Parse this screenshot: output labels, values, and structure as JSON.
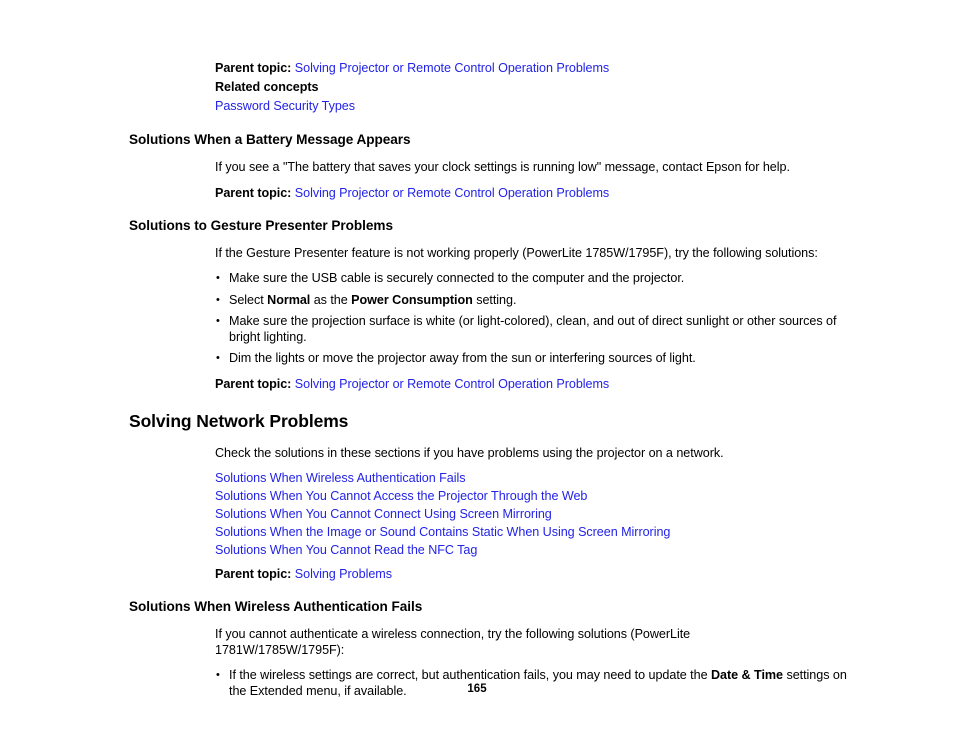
{
  "page": {
    "number": "165",
    "link_color": "#2323e8",
    "text_color": "#000000",
    "background_color": "#ffffff"
  },
  "blocks": {
    "top_parent_topic": {
      "label": "Parent topic:",
      "link": "Solving Projector or Remote Control Operation Problems"
    },
    "related_concepts": {
      "label": "Related concepts",
      "link": "Password Security Types"
    },
    "battery_section": {
      "heading": "Solutions When a Battery Message Appears",
      "paragraph": "If you see a \"The battery that saves your clock settings is running low\" message, contact Epson for help.",
      "parent_topic_label": "Parent topic:",
      "parent_topic_link": "Solving Projector or Remote Control Operation Problems"
    },
    "gesture_section": {
      "heading": "Solutions to Gesture Presenter Problems",
      "paragraph": "If the Gesture Presenter feature is not working properly (PowerLite 1785W/1795F), try the following solutions:",
      "bullets": [
        {
          "parts": [
            {
              "text": "Make sure the USB cable is securely connected to the computer and the projector.",
              "bold": false
            }
          ]
        },
        {
          "parts": [
            {
              "text": "Select ",
              "bold": false
            },
            {
              "text": "Normal",
              "bold": true
            },
            {
              "text": " as the ",
              "bold": false
            },
            {
              "text": "Power Consumption",
              "bold": true
            },
            {
              "text": " setting.",
              "bold": false
            }
          ]
        },
        {
          "parts": [
            {
              "text": "Make sure the projection surface is white (or light-colored), clean, and out of direct sunlight or other sources of bright lighting.",
              "bold": false
            }
          ]
        },
        {
          "parts": [
            {
              "text": "Dim the lights or move the projector away from the sun or interfering sources of light.",
              "bold": false
            }
          ]
        }
      ],
      "bullet_1_text": "Make sure the USB cable is securely connected to the computer and the projector.",
      "bullet_2_prefix": "Select ",
      "bullet_2_bold_a": "Normal",
      "bullet_2_middle": " as the ",
      "bullet_2_bold_b": "Power Consumption",
      "bullet_2_suffix": " setting.",
      "bullet_3_text": "Make sure the projection surface is white (or light-colored), clean, and out of direct sunlight or other sources of bright lighting.",
      "bullet_4_text": "Dim the lights or move the projector away from the sun or interfering sources of light.",
      "parent_topic_label": "Parent topic:",
      "parent_topic_link": "Solving Projector or Remote Control Operation Problems"
    },
    "network_chapter": {
      "heading": "Solving Network Problems",
      "paragraph": "Check the solutions in these sections if you have problems using the projector on a network.",
      "links": [
        "Solutions When Wireless Authentication Fails",
        "Solutions When You Cannot Access the Projector Through the Web",
        "Solutions When You Cannot Connect Using Screen Mirroring",
        "Solutions When the Image or Sound Contains Static When Using Screen Mirroring",
        "Solutions When You Cannot Read the NFC Tag"
      ],
      "link_1": "Solutions When Wireless Authentication Fails",
      "link_2": "Solutions When You Cannot Access the Projector Through the Web",
      "link_3": "Solutions When You Cannot Connect Using Screen Mirroring",
      "link_4": "Solutions When the Image or Sound Contains Static When Using Screen Mirroring",
      "link_5": "Solutions When You Cannot Read the NFC Tag",
      "parent_topic_label": "Parent topic:",
      "parent_topic_link": "Solving Problems"
    },
    "wireless_auth_section": {
      "heading": "Solutions When Wireless Authentication Fails",
      "paragraph": "If you cannot authenticate a wireless connection, try the following solutions (PowerLite 1781W/1785W/1795F):",
      "bullet_prefix": "If the wireless settings are correct, but authentication fails, you may need to update the ",
      "bullet_bold": "Date & Time",
      "bullet_suffix": " settings on the Extended menu, if available."
    }
  }
}
